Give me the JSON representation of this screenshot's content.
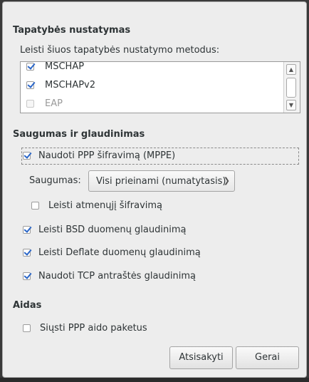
{
  "auth": {
    "title": "Tapatybės nustatymas",
    "methods_label": "Leisti šiuos tapatybės nustatymo metodus:",
    "methods": [
      {
        "label": "MSCHAP",
        "checked": true,
        "enabled": true
      },
      {
        "label": "MSCHAPv2",
        "checked": true,
        "enabled": true
      },
      {
        "label": "EAP",
        "checked": false,
        "enabled": false
      }
    ],
    "scroll_up_icon": "chevron-up-icon",
    "scroll_down_icon": "chevron-down-icon"
  },
  "security": {
    "title": "Saugumas ir glaudinimas",
    "use_mppe": {
      "label": "Naudoti PPP šifravimą (MPPE)",
      "checked": true
    },
    "security_label": "Saugumas:",
    "security_value": "Visi prieinami (numatytasis)",
    "stateful": {
      "label": "Leisti atmenųjį šifravimą",
      "checked": false
    },
    "bsd": {
      "label": "Leisti BSD duomenų glaudinimą",
      "checked": true
    },
    "deflate": {
      "label": "Leisti Deflate duomenų glaudinimą",
      "checked": true
    },
    "tcp": {
      "label": "Naudoti TCP antraštės glaudinimą",
      "checked": true
    }
  },
  "echo": {
    "title": "Aidas",
    "send_echo": {
      "label": "Siųsti PPP aido paketus",
      "checked": false
    }
  },
  "buttons": {
    "cancel": "Atsisakyti",
    "ok": "Gerai"
  },
  "accent_color": "#2a66c8"
}
